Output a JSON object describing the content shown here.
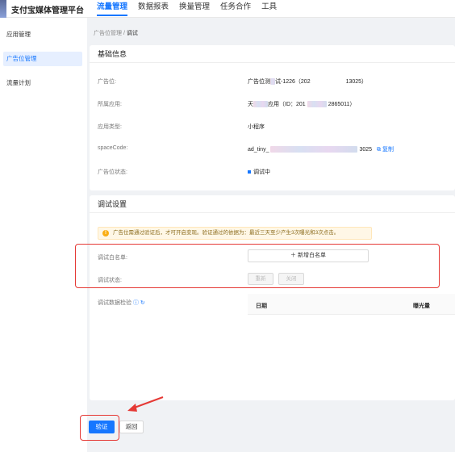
{
  "header": {
    "brand": "支付宝媒体管理平台",
    "nav": [
      "流量管理",
      "数据报表",
      "换量管理",
      "任务合作",
      "工具"
    ]
  },
  "sidebar": {
    "items": [
      "应用管理",
      "广告位管理",
      "流量计划"
    ]
  },
  "breadcrumb": {
    "parent": "广告位管理",
    "sep": "/",
    "current": "调试"
  },
  "basic_info": {
    "title": "基础信息",
    "rows": [
      {
        "label": "广告位:",
        "value_prefix": "广告位测",
        "value_suffix": "试-1226（202",
        "value_end": "13025）"
      },
      {
        "label": "所属应用:",
        "value_prefix": "天",
        "value_mid": "应用（ID：201",
        "value_end": "2865011）"
      },
      {
        "label": "应用类型:",
        "value": "小程序"
      },
      {
        "label": "spaceCode:",
        "value_prefix": "ad_tiny_",
        "value_end": "3025",
        "copy": "复制"
      },
      {
        "label": "广告位状态:",
        "value": "调试中"
      }
    ]
  },
  "debug": {
    "title": "调试设置",
    "alert": "广告位需通过验证后，才可开启变现。验证通过的依据为：最近三天至少产生3次曝光和3次点击。",
    "whitelist_label": "调试白名单:",
    "whitelist_button": "新增白名单",
    "status_label": "调试状态:",
    "btn_restart": "重新",
    "btn_close": "关闭",
    "check_label": "调试数据检验",
    "table_headers": [
      "日期",
      "曝光量"
    ]
  },
  "footer": {
    "verify": "验证",
    "back": "返回"
  },
  "colors": {
    "accent": "#1677ff",
    "highlight": "#e53935"
  }
}
